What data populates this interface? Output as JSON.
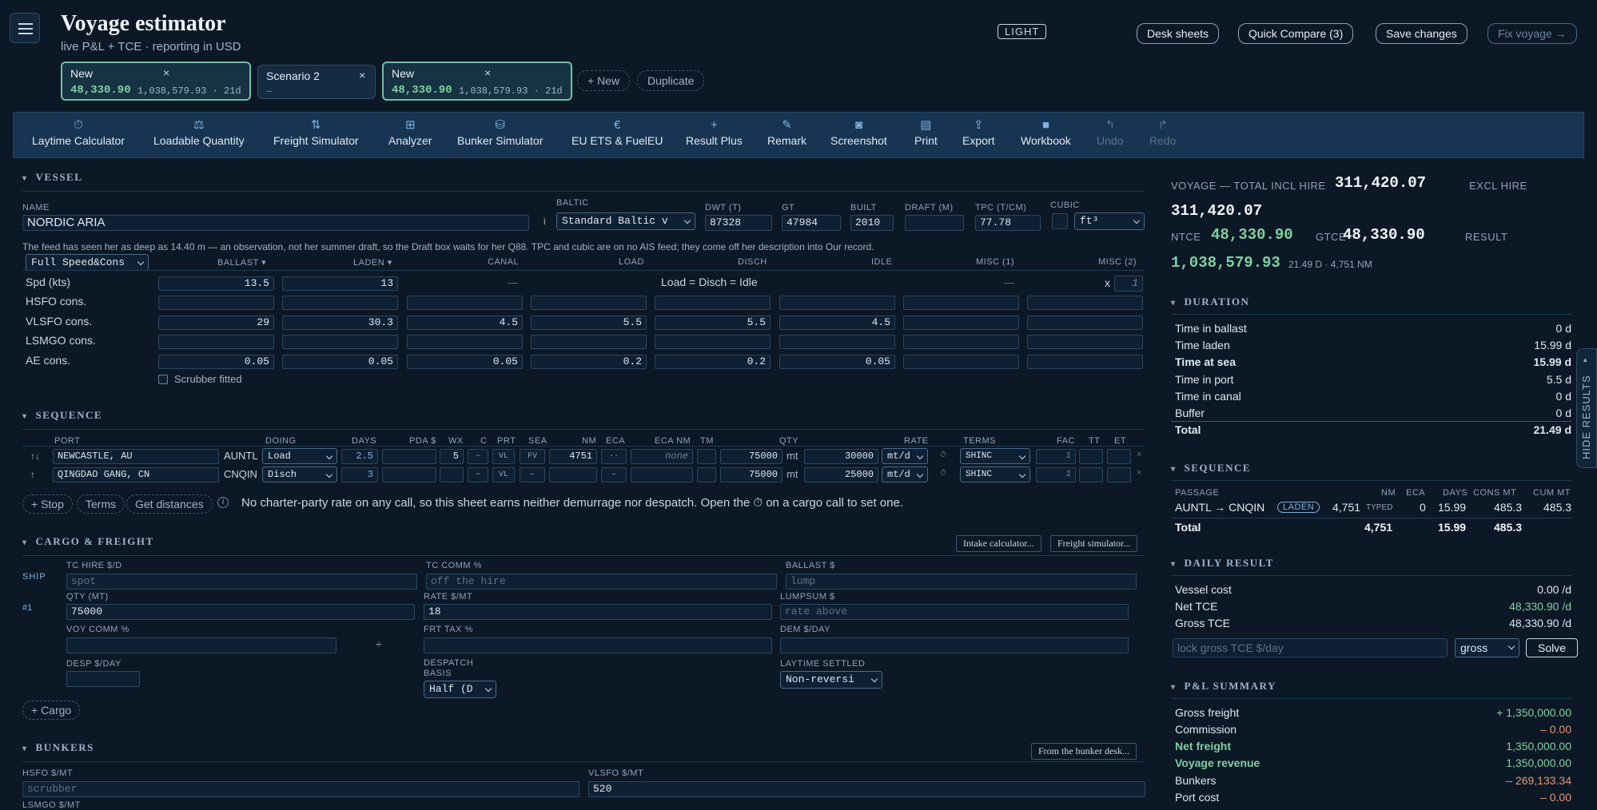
{
  "header": {
    "title": "Voyage estimator",
    "subtitle": "live P&L + TCE · reporting in USD",
    "theme_toggle": "LIGHT",
    "buttons": [
      "Desk sheets",
      "Quick Compare (3)",
      "Save changes",
      "Fix voyage →"
    ]
  },
  "scenarios": [
    {
      "name": "New",
      "tce": "48,330.90",
      "detail": "1,038,579.93 · 21d"
    },
    {
      "name": "Scenario 2",
      "tce": "",
      "detail": "…"
    },
    {
      "name": "New",
      "tce": "48,330.90",
      "detail": "1,038,579.93 · 21d"
    }
  ],
  "scenario_actions": {
    "new": "+ New",
    "duplicate": "Duplicate"
  },
  "toolbar": [
    {
      "label": "Laytime Calculator",
      "icon": "stopwatch-icon"
    },
    {
      "label": "Loadable Quantity",
      "icon": "scale-icon"
    },
    {
      "label": "Freight Simulator",
      "icon": "arrows-icon"
    },
    {
      "label": "Analyzer",
      "icon": "grid-icon"
    },
    {
      "label": "Bunker Simulator",
      "icon": "database-icon"
    },
    {
      "label": "EU ETS & FuelEU",
      "icon": "euro-icon"
    },
    {
      "label": "Result Plus",
      "icon": "plus-icon"
    },
    {
      "label": "Remark",
      "icon": "pen-icon"
    },
    {
      "label": "Screenshot",
      "icon": "camera-icon"
    },
    {
      "label": "Print",
      "icon": "print-icon"
    },
    {
      "label": "Export",
      "icon": "export-icon"
    },
    {
      "label": "Workbook",
      "icon": "book-icon"
    },
    {
      "label": "Undo",
      "icon": "undo-icon"
    },
    {
      "label": "Redo",
      "icon": "redo-icon"
    }
  ],
  "vessel": {
    "section": "VESSEL",
    "labels": {
      "name": "NAME",
      "baltic": "BALTIC",
      "dwt": "DWT (T)",
      "gt": "GT",
      "built": "BUILT",
      "draft": "DRAFT (M)",
      "tpc": "TPC (T/CM)",
      "cubic": "CUBIC"
    },
    "name": "NORDIC ARIA",
    "baltic": "Standard Baltic v",
    "dwt": "87328",
    "gt": "47984",
    "built": "2010",
    "draft": "",
    "tpc": "77.78",
    "cubic_unit": "ft³",
    "note": "The feed has seen her as deep as 14.40 m — an observation, not her summer draft, so the Draft box waits for her Q88. TPC and cubic are on no AIS feed; they come off her description into Our record.",
    "speed_mode": "Full Speed&Cons",
    "columns": [
      "BALLAST",
      "LADEN",
      "CANAL",
      "LOAD",
      "DISCH",
      "IDLE",
      "MISC (1)",
      "MISC (2)"
    ],
    "rows": [
      {
        "label": "Spd (kts)",
        "values": [
          "13.5",
          "13",
          "—",
          "",
          "",
          "",
          "—",
          ""
        ]
      },
      {
        "label": "HSFO cons.",
        "values": [
          "",
          "",
          "",
          "",
          "",
          "",
          "",
          ""
        ]
      },
      {
        "label": "VLSFO cons.",
        "values": [
          "29",
          "30.3",
          "4.5",
          "5.5",
          "5.5",
          "4.5",
          "",
          ""
        ]
      },
      {
        "label": "LSMGO cons.",
        "values": [
          "",
          "",
          "",
          "",
          "",
          "",
          "",
          ""
        ]
      },
      {
        "label": "AE cons.",
        "values": [
          "0.05",
          "0.05",
          "0.05",
          "0.2",
          "0.2",
          "0.05",
          "",
          ""
        ]
      }
    ],
    "merged_note": "Load = Disch = Idle",
    "misc2_x": "x",
    "misc2_val": "1",
    "scrubber": "Scrubber fitted"
  },
  "sequence": {
    "section": "SEQUENCE",
    "columns": [
      "PORT",
      "DOING",
      "DAYS",
      "PDA $",
      "WX",
      "C",
      "PRT",
      "SEA",
      "NM",
      "ECA",
      "ECA NM",
      "TM",
      "QTY",
      "RATE",
      "TERMS",
      "FAC",
      "TT",
      "ET"
    ],
    "rows": [
      {
        "arrow": "↑↓",
        "port": "NEWCASTLE, AU",
        "code": "AUNTL",
        "doing": "Load",
        "days": "2.5",
        "wx": "5",
        "c": "–",
        "prt": "VL",
        "sea": "FV",
        "nm": "4751",
        "eca": "··",
        "eca_nm": "none",
        "qty": "75000",
        "qty_unit": "mt",
        "rate": "30000",
        "rate_unit": "mt/d",
        "terms": "SHINC",
        "fac": "1"
      },
      {
        "arrow": "↑",
        "port": "QINGDAO GANG, CN",
        "code": "CNQIN",
        "doing": "Disch",
        "days": "3",
        "wx": "",
        "c": "–",
        "prt": "VL",
        "sea": "–",
        "nm": "",
        "eca": "–",
        "eca_nm": "",
        "qty": "75000",
        "qty_unit": "mt",
        "rate": "25000",
        "rate_unit": "mt/d",
        "terms": "SHINC",
        "fac": "1"
      }
    ],
    "actions": [
      "+ Stop",
      "Terms",
      "Get distances"
    ],
    "info": "No charter-party rate on any call, so this sheet earns neither demurrage nor despatch. Open the ⏱ on a cargo call to set one."
  },
  "cargo": {
    "section": "CARGO & FREIGHT",
    "buttons": [
      "Intake calculator...",
      "Freight simulator..."
    ],
    "ship": "SHIP",
    "cargo_no": "#1",
    "labels": {
      "tc_hire": "TC HIRE $/D",
      "tc_comm": "TC COMM %",
      "ballast": "BALLAST $",
      "qty": "QTY (MT)",
      "rate": "RATE $/MT",
      "lumpsum": "LUMPSUM $",
      "voy_comm": "VOY COMM %",
      "frt_tax": "FRT TAX %",
      "dem": "DEM $/DAY",
      "desp": "DESP $/DAY",
      "despatch_basis": "DESPATCH BASIS",
      "laytime": "LAYTIME SETTLED"
    },
    "tc_hire_ph": "spot",
    "tc_comm_ph": "off the hire",
    "ballast_ph": "lump",
    "qty": "75000",
    "rate": "18",
    "lumpsum_ph": "rate above",
    "despatch_basis": "Half (D",
    "laytime": "Non-reversi",
    "add": "+ Cargo"
  },
  "bunkers": {
    "section": "BUNKERS",
    "button": "From the bunker desk...",
    "hsfo_label": "HSFO $/MT",
    "hsfo_ph": "scrubber",
    "vlsfo_label": "VLSFO $/MT",
    "vlsfo": "520",
    "lsmgo_label": "LSMGO $/MT"
  },
  "summary": {
    "label": "VOYAGE — TOTAL INCL HIRE",
    "total": "311,420.07",
    "excl_label": "EXCL HIRE",
    "excl": "311,420.07",
    "ntce_label": "NTCE",
    "ntce": "48,330.90",
    "gtce_label": "GTCE",
    "gtce": "48,330.90",
    "result_label": "RESULT",
    "result": "1,038,579.93",
    "result_meta": "21.49 D · 4,751 NM"
  },
  "duration": {
    "section": "DURATION",
    "rows": [
      {
        "k": "Time in ballast",
        "v": "0 d"
      },
      {
        "k": "Time laden",
        "v": "15.99 d"
      },
      {
        "k": "Time at sea",
        "v": "15.99 d"
      },
      {
        "k": "Time in port",
        "v": "5.5 d"
      },
      {
        "k": "Time in canal",
        "v": "0 d"
      },
      {
        "k": "Buffer",
        "v": "0 d"
      },
      {
        "k": "Total",
        "v": "21.49 d"
      }
    ]
  },
  "seq_summary": {
    "section": "SEQUENCE",
    "columns": [
      "PASSAGE",
      "NM",
      "ECA",
      "DAYS",
      "CONS MT",
      "CUM MT"
    ],
    "row": {
      "passage": "AUNTL → CNQIN",
      "badge": "LADEN",
      "nm": "4,751",
      "typed": "TYPED",
      "eca": "0",
      "days": "15.99",
      "cons": "485.3",
      "cum": "485.3"
    },
    "total": {
      "label": "Total",
      "nm": "4,751",
      "days": "15.99",
      "cons": "485.3"
    }
  },
  "daily": {
    "section": "DAILY RESULT",
    "rows": [
      {
        "k": "Vessel cost",
        "v": "0.00 /d"
      },
      {
        "k": "Net TCE",
        "v": "48,330.90 /d"
      },
      {
        "k": "Gross TCE",
        "v": "48,330.90 /d"
      }
    ],
    "lock_ph": "lock gross TCE $/day",
    "mode": "gross",
    "solve": "Solve"
  },
  "pnl": {
    "section": "P&L SUMMARY",
    "rows": [
      {
        "k": "Gross freight",
        "v": "+ 1,350,000.00"
      },
      {
        "k": "Commission",
        "v": "– 0.00"
      },
      {
        "k": "Net freight",
        "v": "1,350,000.00"
      },
      {
        "k": "Voyage revenue",
        "v": "1,350,000.00"
      },
      {
        "k": "Bunkers",
        "v": "– 269,133.34"
      },
      {
        "k": "Port cost",
        "v": "– 0.00"
      }
    ]
  },
  "hide_results": "HIDE RESULTS",
  "colors": {
    "bg": "#0c1826",
    "accent_green": "#7fd0a0",
    "accent_orange": "#e89870",
    "panel": "#142b42"
  }
}
